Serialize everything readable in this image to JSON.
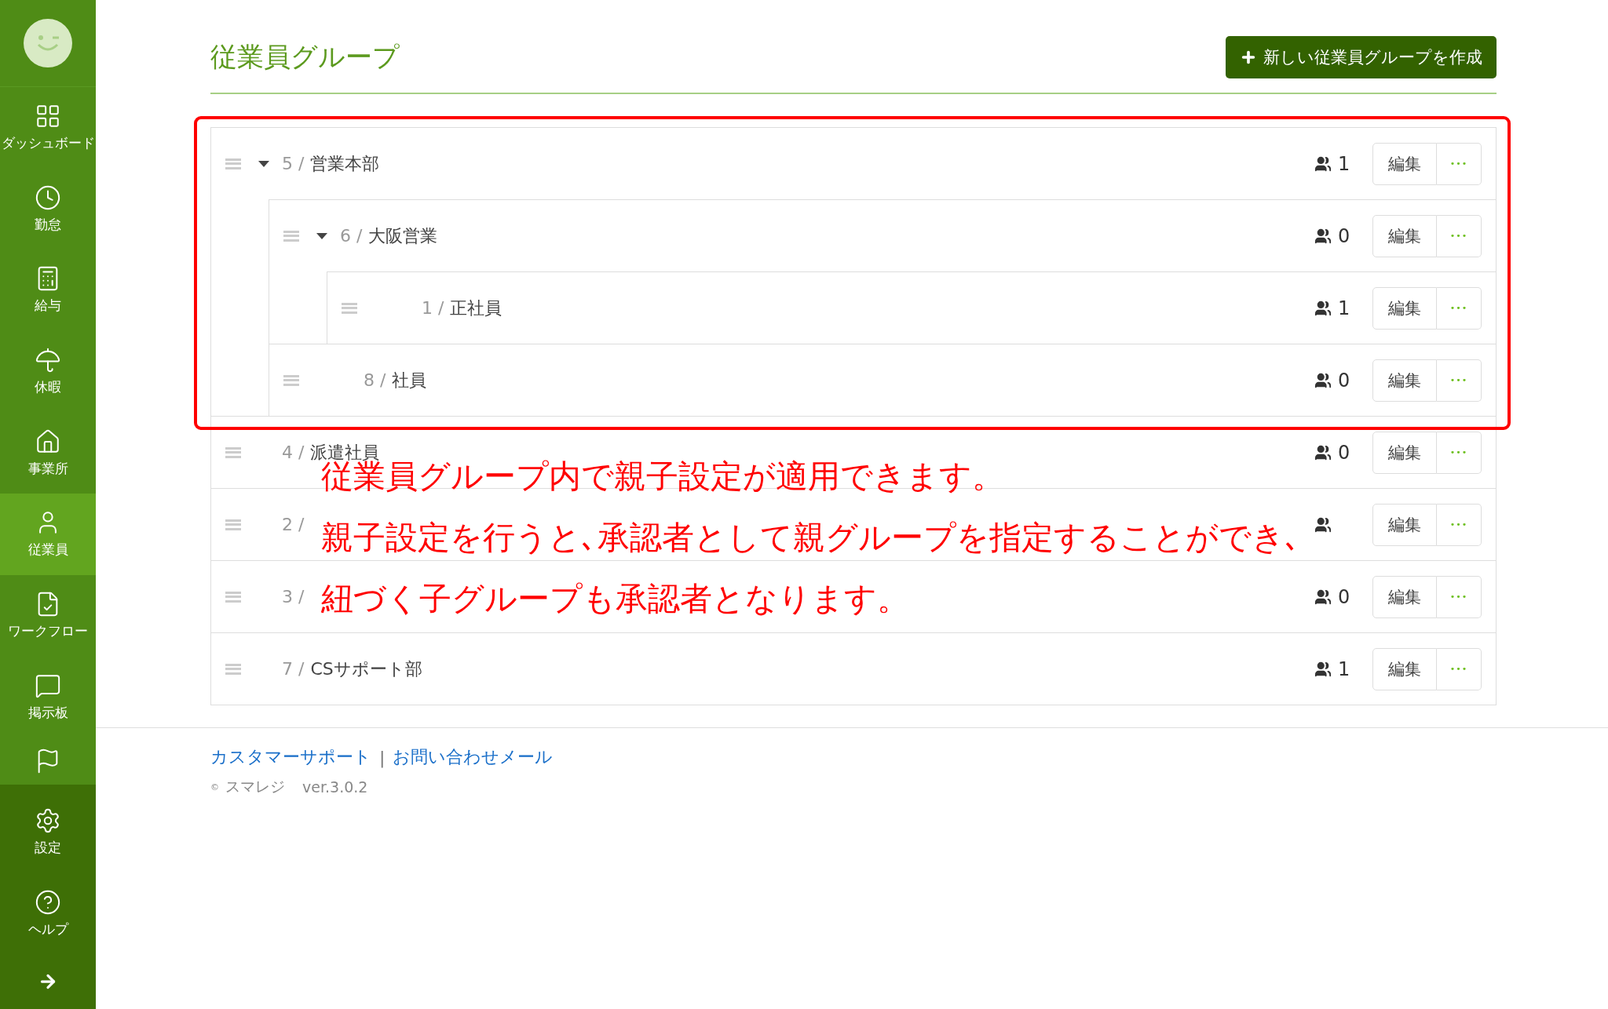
{
  "sidebar": {
    "items": [
      {
        "label": "ダッシュボード",
        "selected": false
      },
      {
        "label": "勤怠",
        "selected": false
      },
      {
        "label": "給与",
        "selected": false
      },
      {
        "label": "休暇",
        "selected": false
      },
      {
        "label": "事業所",
        "selected": false
      },
      {
        "label": "従業員",
        "selected": true
      },
      {
        "label": "ワークフロー",
        "selected": false
      },
      {
        "label": "掲示板",
        "selected": false
      }
    ],
    "bottom_items": [
      {
        "label": "設定"
      },
      {
        "label": "ヘルプ"
      }
    ]
  },
  "page": {
    "title": "従業員グループ",
    "create_button": "新しい従業員グループを作成"
  },
  "groups": [
    {
      "id": "5 /",
      "name": "営業本部",
      "count": "1",
      "edit": "編集",
      "more": "•••",
      "expanded": true,
      "children": [
        {
          "id": "6 /",
          "name": "大阪営業",
          "count": "0",
          "edit": "編集",
          "more": "•••",
          "expanded": true,
          "children": [
            {
              "id": "1 /",
              "name": "正社員",
              "count": "1",
              "edit": "編集",
              "more": "•••"
            }
          ]
        },
        {
          "id": "8 /",
          "name": "社員",
          "count": "0",
          "edit": "編集",
          "more": "•••"
        }
      ]
    },
    {
      "id": "4 /",
      "name": "派遣社員",
      "count": "0",
      "edit": "編集",
      "more": "•••"
    },
    {
      "id": "2 /",
      "edit": "編集",
      "more": "•••"
    },
    {
      "id": "3 /",
      "count": "0",
      "edit": "編集",
      "more": "•••"
    },
    {
      "id": "7 /",
      "name": "CSサポート部",
      "count": "1",
      "edit": "編集",
      "more": "•••"
    }
  ],
  "annotation": {
    "lines": [
      "従業員グループ内で親子設定が適用できます。",
      "親子設定を行うと､承認者として親グループを指定することができ､",
      "紐づく子グループも承認者となります。"
    ]
  },
  "footer": {
    "links": [
      "カスタマーサポート",
      "お問い合わせメール"
    ],
    "separator": "|",
    "copyright": "©",
    "company": "スマレジ",
    "version": "ver.3.0.2"
  }
}
